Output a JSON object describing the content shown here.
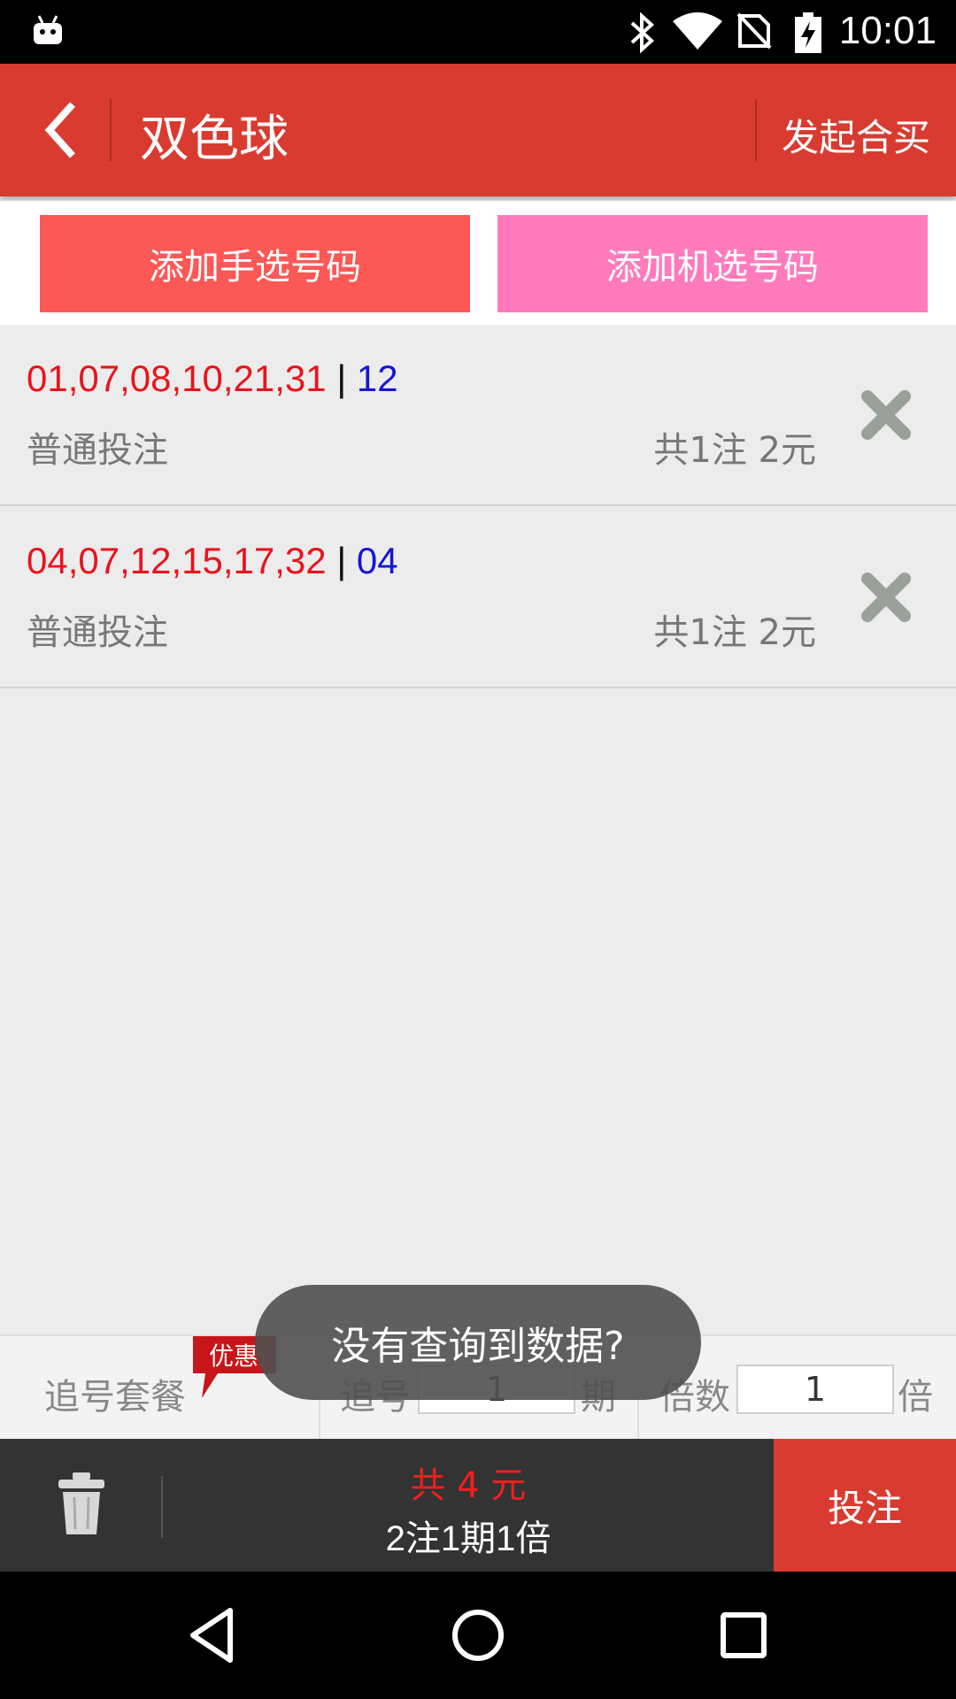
{
  "status_bar": {
    "time": "10:01",
    "icons": [
      "android-icon",
      "bluetooth-icon",
      "wifi-icon",
      "no-sim-icon",
      "battery-charging-icon"
    ]
  },
  "header": {
    "title": "双色球",
    "action_label": "发起合买",
    "back_icon": "chevron-left-icon"
  },
  "add_buttons": {
    "manual_label": "添加手选号码",
    "random_label": "添加机选号码"
  },
  "bets": [
    {
      "red": "01,07,08,10,21,31",
      "separator": "|",
      "blue": "12",
      "type": "普通投注",
      "summary": "共1注  2元"
    },
    {
      "red": "04,07,12,15,17,32",
      "separator": "|",
      "blue": "04",
      "type": "普通投注",
      "summary": "共1注  2元"
    }
  ],
  "options": {
    "package_label": "追号套餐",
    "promo_badge": "优惠",
    "chase_label": "追号",
    "chase_value": "1",
    "chase_unit": "期",
    "multiple_label": "倍数",
    "multiple_value": "1",
    "multiple_unit": "倍"
  },
  "toast": {
    "message": "没有查询到数据?"
  },
  "action_bar": {
    "total": "共  4 元",
    "detail": "2注1期1倍",
    "submit_label": "投注"
  },
  "colors": {
    "header": "#d93b30",
    "manual_button": "#fc5856",
    "random_button": "#ff7bbc",
    "red_ball": "#e8141d",
    "blue_ball": "#1515d8"
  }
}
